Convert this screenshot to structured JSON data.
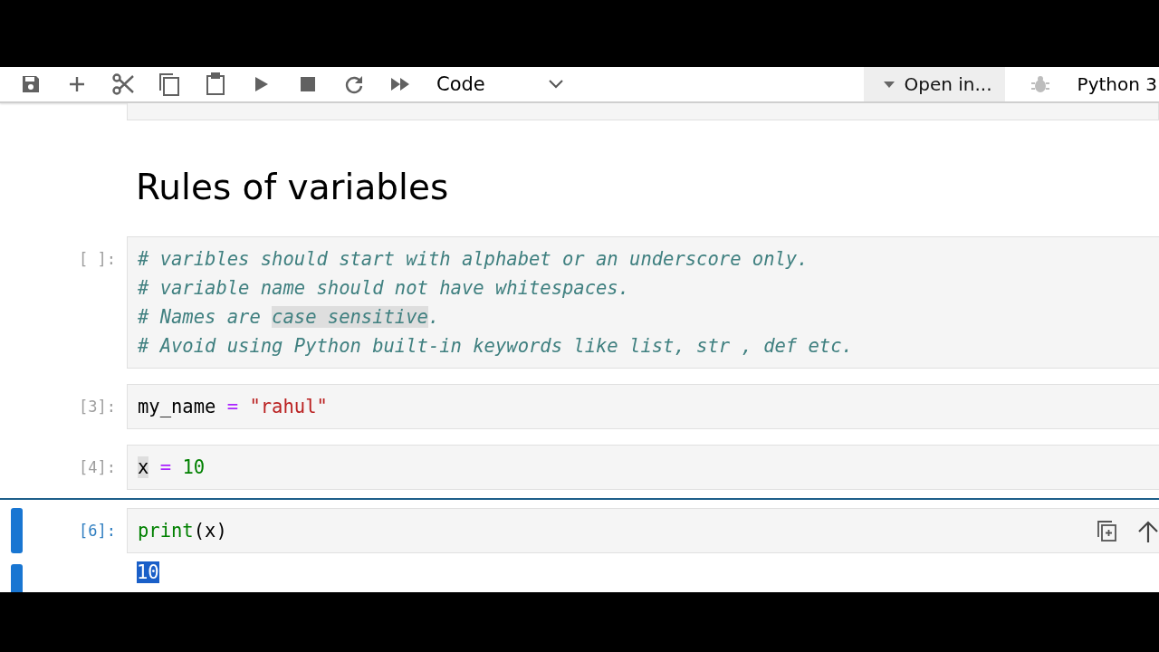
{
  "toolbar": {
    "cell_type": "Code",
    "open_in": "Open in...",
    "kernel": "Python 3"
  },
  "heading": "Rules of variables",
  "cells": [
    {
      "prompt": "[ ]:",
      "selected": false,
      "lines": [
        [
          {
            "kind": "comment",
            "text": "# varibles should start with alphabet or an underscore only."
          }
        ],
        [
          {
            "kind": "comment",
            "text": "# variable name should not have whitespaces."
          }
        ],
        [
          {
            "kind": "comment",
            "text": "# Names are "
          },
          {
            "kind": "comment",
            "text": "case sensitive",
            "highlighted": true
          },
          {
            "kind": "comment",
            "text": "."
          }
        ],
        [
          {
            "kind": "comment",
            "text": "# Avoid using Python built-in keywords like list, str , def etc."
          }
        ]
      ]
    },
    {
      "prompt": "[3]:",
      "selected": false,
      "lines": [
        [
          {
            "kind": "name",
            "text": "my_name"
          },
          {
            "kind": "op",
            "text": " = "
          },
          {
            "kind": "string",
            "text": "\"rahul\""
          }
        ]
      ]
    },
    {
      "prompt": "[4]:",
      "selected": false,
      "lines": [
        [
          {
            "kind": "name",
            "text": "x",
            "highlighted": true
          },
          {
            "kind": "op",
            "text": " = "
          },
          {
            "kind": "number",
            "text": "10"
          }
        ]
      ]
    },
    {
      "prompt": "[6]:",
      "selected": true,
      "lines": [
        [
          {
            "kind": "builtin",
            "text": "print"
          },
          {
            "kind": "name",
            "text": "(x)"
          }
        ]
      ],
      "output": {
        "text": "10",
        "highlighted": true
      }
    }
  ]
}
